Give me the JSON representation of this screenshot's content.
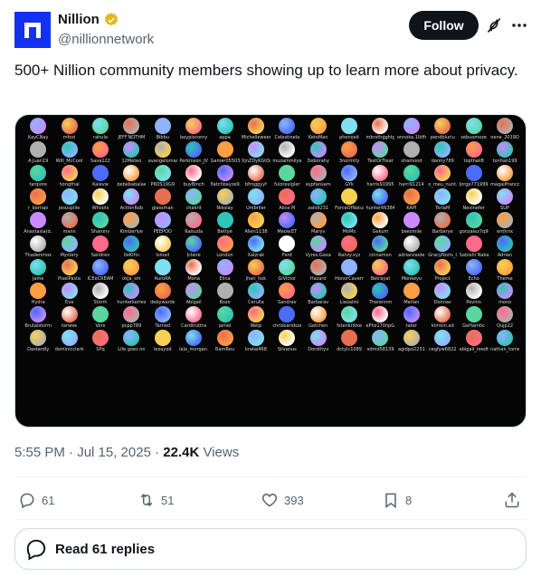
{
  "author": {
    "display_name": "Nillion",
    "handle": "@nillionnetwork",
    "logo_color": "#1232f0",
    "verified_badge": "gold-check-icon"
  },
  "follow_label": "Follow",
  "tweet_text": "500+ Nillion community members showing up to learn more about privacy.",
  "media": {
    "palette": [
      "#8fb3ff",
      "#ff9f43",
      "#5bd6a0",
      "#f7d154",
      "#c98bff",
      "#ff6b8b",
      "#7ee0f0",
      "#b0b0b0",
      "#4a6cf7",
      "#e76f51",
      "#2ec4b6",
      "#ffffff"
    ],
    "rows": [
      [
        "KayCNay",
        "mfozi",
        "rahula",
        "JEFF.NOTHM",
        "Bibbu",
        "beypiscorny",
        "appa",
        "Michelleween...",
        "Celestinela",
        "KetoMan",
        "phenoeit",
        "mbrsthgghtg",
        "onnoka.1lkffe",
        "pendbluriu",
        "sebuomoze",
        "nene_2019D"
      ],
      [
        "A.Juan19",
        "Will_McCool",
        "Sava122",
        "12Meteo",
        "avangelomanci...",
        "Perkinson_JV",
        "Gamer05503...",
        "XjnZDyKGtOd...",
        "muzammilyas...",
        "Deborahy",
        "3normity",
        "TestOrTreat",
        "shamood",
        "danny789",
        "topthail8",
        "tonhan199"
      ],
      [
        "tanpore",
        "hongthai",
        "Kaievw",
        "bebebabalaes",
        "PKOS19G9",
        "buyBinch",
        "flatchbayze9",
        "bfroggyyf",
        "fulorexigler",
        "eypfansam",
        "GYk",
        "harris91995",
        "harri91214",
        "o_meu_nunt...",
        "Jorge771999",
        "magalifranco20"
      ],
      [
        "r_borrajo",
        "jesuspille",
        "Whoots",
        "ActionRob",
        "glassman",
        "chakrit",
        "Nikolay",
        "Umbriler",
        "Alice.M",
        "zalo9231",
        "ForceOfNature",
        "hunter66384",
        "KAPI",
        "ToriaM",
        "Nevinefer",
        "SUP"
      ],
      [
        "Anastasia(d...",
        "mann",
        "Sharonv",
        "Kimberlye",
        "PEEPOO",
        "Raisuda",
        "Bettye",
        "Alien1138",
        "Meow.ET",
        "Maryv",
        "MoMo",
        "Gekum",
        "beesmile",
        "Barbarye",
        "gonzalez7q9u5",
        "enthrix"
      ],
      [
        "Thadenmox",
        "Mystery",
        "Sandrev",
        "0eKihn",
        "Ismail",
        "Jclaire",
        "London",
        "Xalzrak",
        "Ferd",
        "Vyres.Gaxa",
        "Ranzy.xyz",
        "cinnamon",
        "adrianzaide",
        "GracyNoris_L...",
        "Satoshi Naka...",
        "Adrian"
      ],
      [
        "Jame",
        "PixelPasta",
        "ICEeCREAM",
        "okja_sm",
        "AuroRA",
        "Mona",
        "Elina",
        "jhan_hok",
        "GiVictor",
        "Hazard",
        "HonorCavern",
        "Betrayat",
        "Monkeyo",
        "Project",
        "Echo",
        "Theme"
      ],
      [
        "Hydra",
        "Eva",
        "Storm",
        "hunterkorreas",
        "debywards",
        "Abigail",
        "Bozo",
        "Cerulla",
        "Sandrav",
        "Barbarav",
        "Liaoaimi",
        "Therennm",
        "Marian",
        "Donnav",
        "Pavinn",
        "mono"
      ],
      [
        "Brutalstorm",
        "tarwee",
        "Vorx",
        "pcpp789",
        "Tarned",
        "Cardtruttra",
        "jamel",
        "Wetp",
        "chrisbaridson",
        "Getchen",
        "fstenkrikke",
        "ePhs170npGe",
        "tater",
        "kirnkin.ad",
        "GeHamtic",
        "Qujp22"
      ],
      [
        "Dastardly",
        "dominicclark2",
        "SPq",
        "Life goes on",
        "lexayod",
        "lala_morgan...",
        "BamBeu",
        "kratai468",
        "Silvanus",
        "Dorothyv",
        "dctylc1089",
        "vdmd58139",
        "agidpo2231",
        "cegfyw6822",
        "abigail_reedt...",
        "nathan_torre..."
      ]
    ]
  },
  "timestamp": "5:55 PM · Jul 15, 2025",
  "views_count": "22.4K",
  "views_label": "Views",
  "stats": {
    "replies": "61",
    "reposts": "51",
    "likes": "393",
    "bookmarks": "8"
  },
  "read_replies_label": "Read 61 replies"
}
